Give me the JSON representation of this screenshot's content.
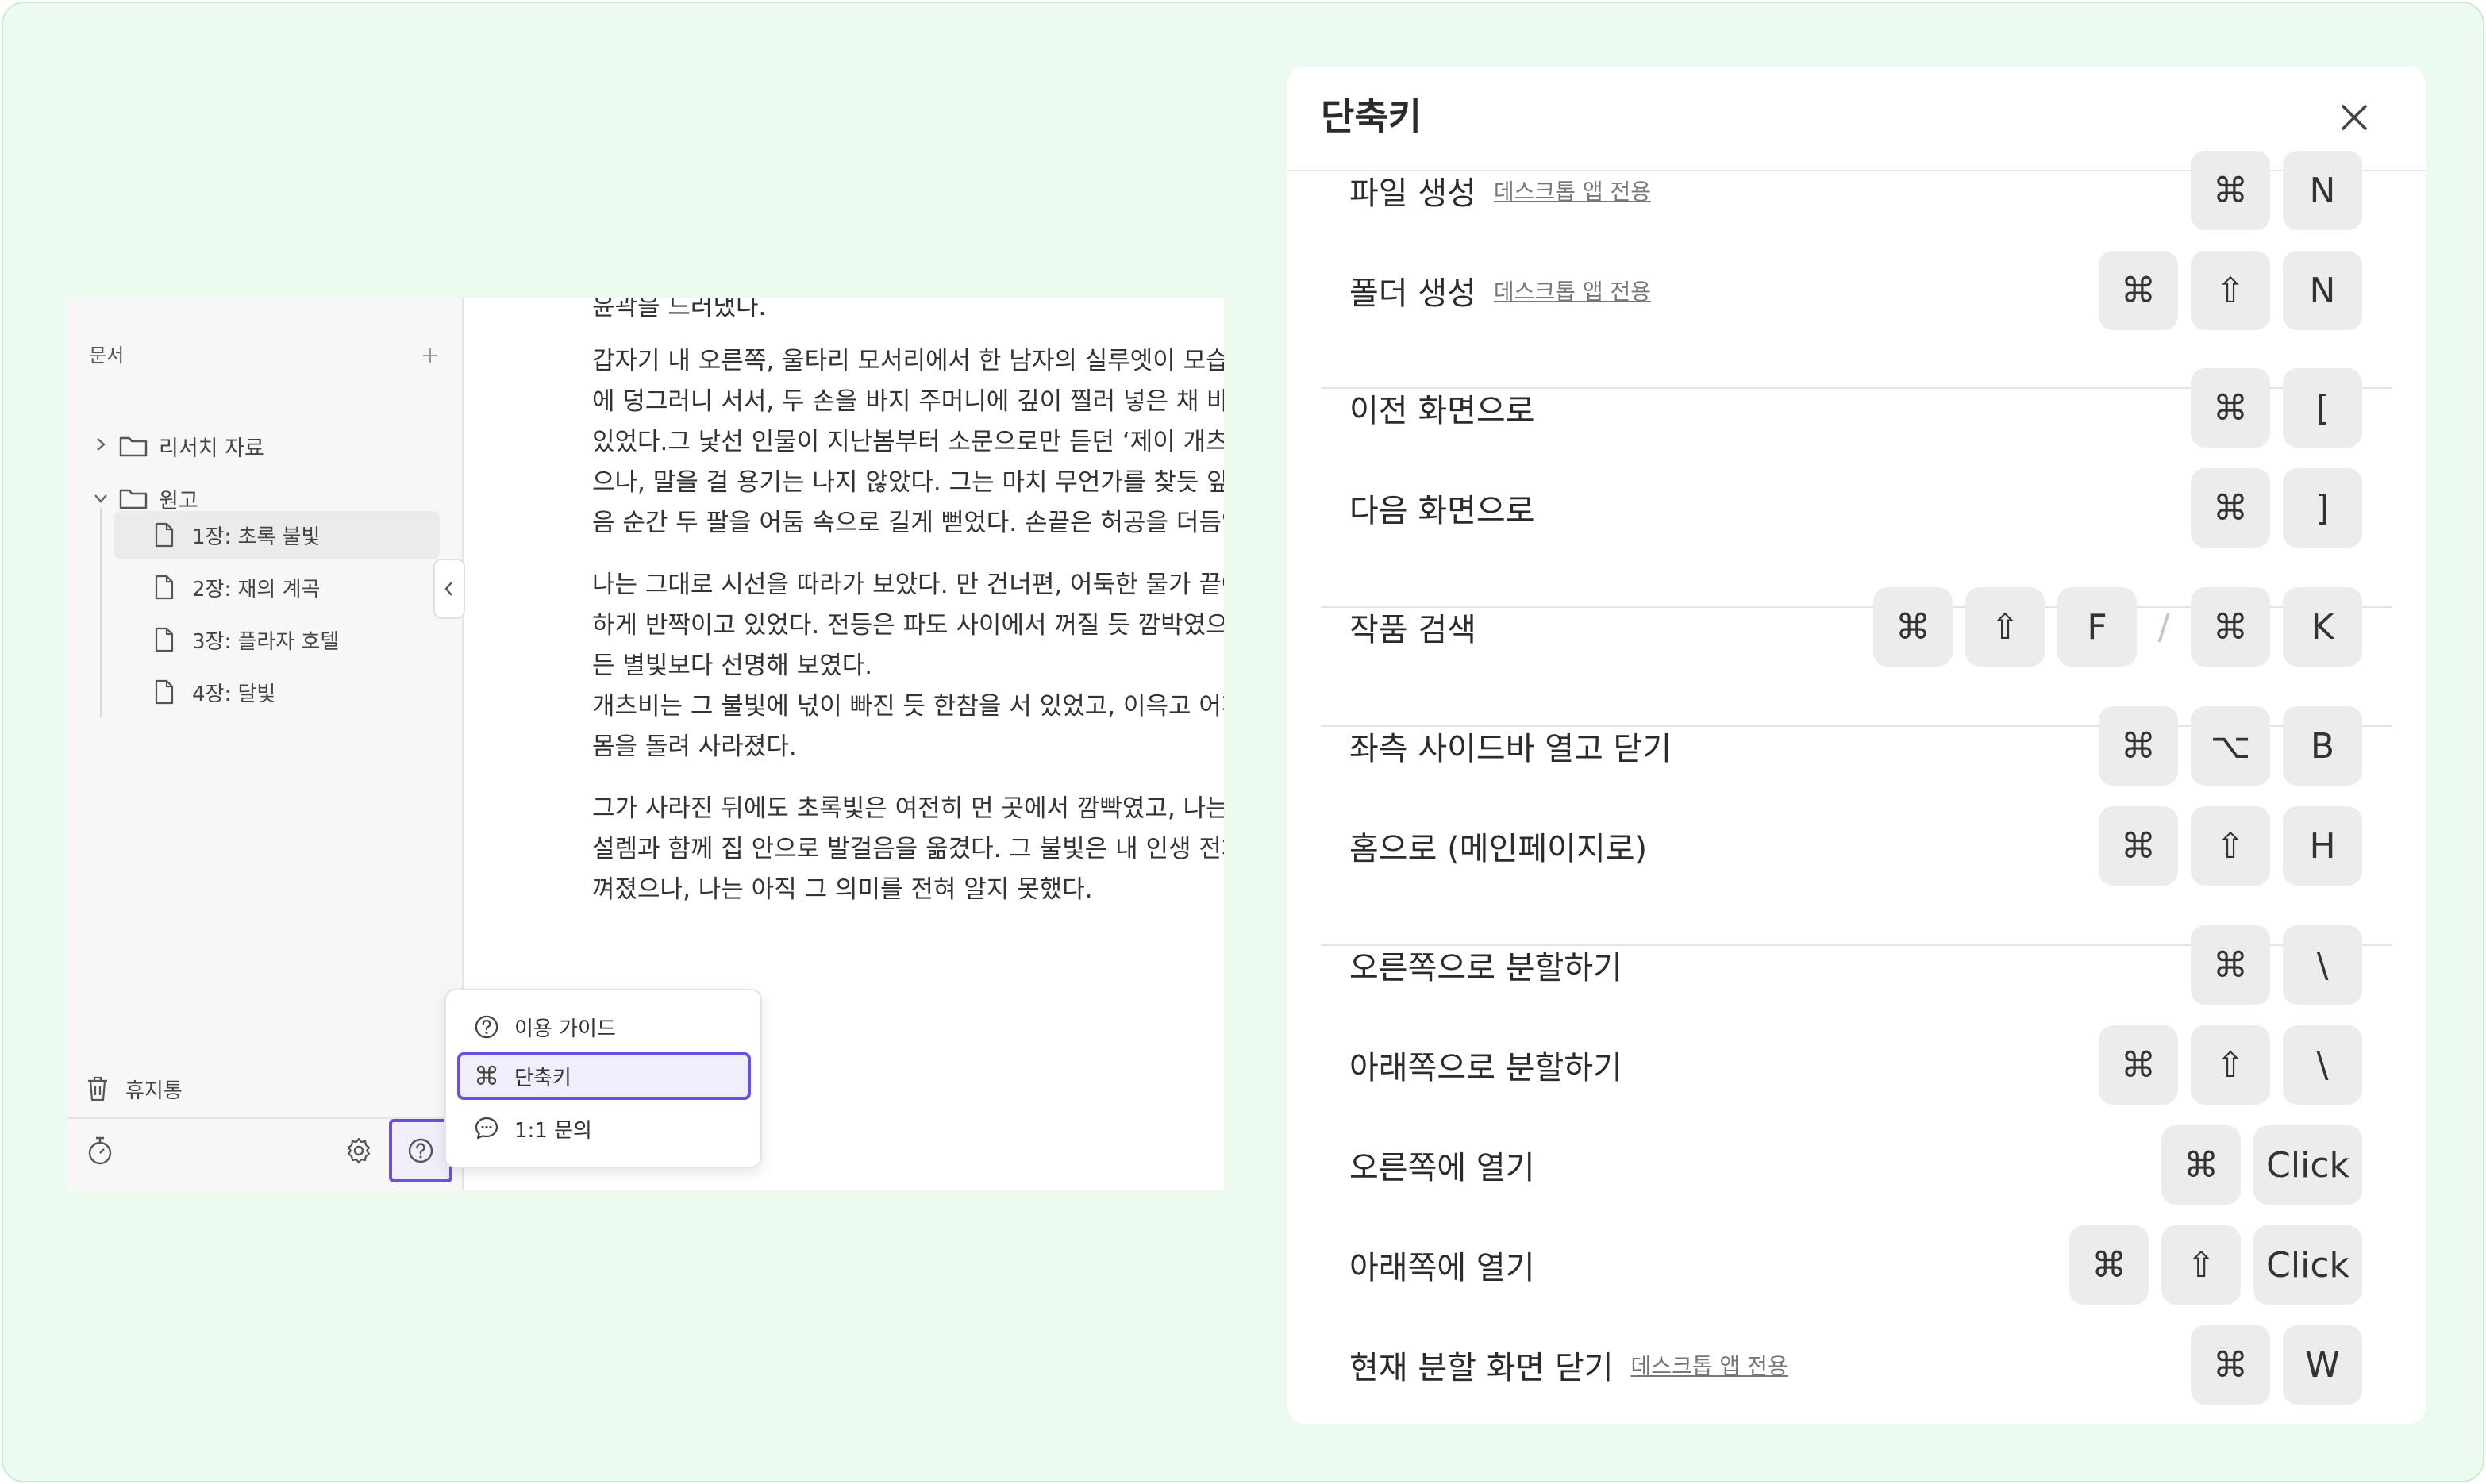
{
  "sidebar": {
    "title": "문서",
    "add_icon": "plus-icon",
    "folders": [
      {
        "label": "리서치 자료",
        "expanded": false
      },
      {
        "label": "원고",
        "expanded": true
      }
    ],
    "documents": [
      {
        "label": "1장: 초록 불빛",
        "active": true
      },
      {
        "label": "2장: 재의 계곡",
        "active": false
      },
      {
        "label": "3장: 플라자 호텔",
        "active": false
      },
      {
        "label": "4장: 달빛",
        "active": false
      }
    ],
    "trash_label": "휴지통"
  },
  "editor": {
    "paragraphs": [
      "윤곽을 드러냈다.",
      "갑자기 내 오른쪽, 울타리 모서리에서 한 남자의 실루엣이 모습을 드\n에 덩그러니 서서, 두 손을 바지 주머니에 깊이 찔러 넣은 채 바다를\n있었다.그 낯선 인물이 지난봄부터 소문으로만 듣던 ‘제이 개츠비’라\n으나, 말을 걸 용기는 나지 않았다. 그는 마치 무언가를 찾듯 앞으로\n음 순간 두 팔을 어둠 속으로 길게 뻗었다. 손끝은 허공을 더듬었고",
      "나는 그대로 시선을 따라가 보았다. 만 건너편, 어둑한 물가 끝에 초\n하게 반짝이고 있었다. 전등은 파도 사이에서 꺼질 듯 깜박였으나,\n든 별빛보다 선명해 보였다.\n개츠비는 그 불빛에 넋이 빠진 듯 한참을 서 있었고, 이윽고 어깨를\n몸을 돌려 사라졌다.",
      "그가 사라진 뒤에도 초록빛은 여전히 먼 곳에서 깜빡였고, 나는 이\n설렘과 함께 집 안으로 발걸음을 옮겼다. 그 불빛은 내 인생 전체를\n껴졌으나, 나는 아직 그 의미를 전혀 알지 못했다."
    ]
  },
  "help_menu": {
    "items": [
      {
        "icon": "help-circle-icon",
        "label": "이용 가이드",
        "active": false
      },
      {
        "icon": "command-icon",
        "label": "단축키",
        "active": true
      },
      {
        "icon": "chat-bubble-icon",
        "label": "1:1 문의",
        "active": false
      }
    ]
  },
  "shortcuts": {
    "title": "단축키",
    "desktop_only_tag": "데스크톱 앱 전용",
    "rows": [
      {
        "label": "파일 생성",
        "desktop_only": true,
        "keys": [
          "⌘",
          "N"
        ]
      },
      {
        "label": "폴더 생성",
        "desktop_only": true,
        "keys": [
          "⌘",
          "⇧",
          "N"
        ]
      },
      {
        "label": "이전 화면으로",
        "desktop_only": false,
        "keys": [
          "⌘",
          "["
        ]
      },
      {
        "label": "다음 화면으로",
        "desktop_only": false,
        "keys": [
          "⌘",
          "]"
        ]
      },
      {
        "label": "작품 검색",
        "desktop_only": false,
        "keys": [
          "⌘",
          "⇧",
          "F",
          "/",
          "⌘",
          "K"
        ]
      },
      {
        "label": "좌측 사이드바 열고 닫기",
        "desktop_only": false,
        "keys": [
          "⌘",
          "⌥",
          "B"
        ]
      },
      {
        "label": "홈으로 (메인페이지로)",
        "desktop_only": false,
        "keys": [
          "⌘",
          "⇧",
          "H"
        ]
      },
      {
        "label": "오른쪽으로 분할하기",
        "desktop_only": false,
        "keys": [
          "⌘",
          "\\"
        ]
      },
      {
        "label": "아래쪽으로 분할하기",
        "desktop_only": false,
        "keys": [
          "⌘",
          "⇧",
          "\\"
        ]
      },
      {
        "label": "오른쪽에 열기",
        "desktop_only": false,
        "keys": [
          "⌘",
          "Click"
        ]
      },
      {
        "label": "아래쪽에 열기",
        "desktop_only": false,
        "keys": [
          "⌘",
          "⇧",
          "Click"
        ]
      },
      {
        "label": "현재 분할 화면 닫기",
        "desktop_only": true,
        "keys": [
          "⌘",
          "W"
        ]
      }
    ]
  },
  "colors": {
    "background": "#ecfaf0",
    "accent": "#6c4fe0",
    "key_background": "#ececec"
  }
}
